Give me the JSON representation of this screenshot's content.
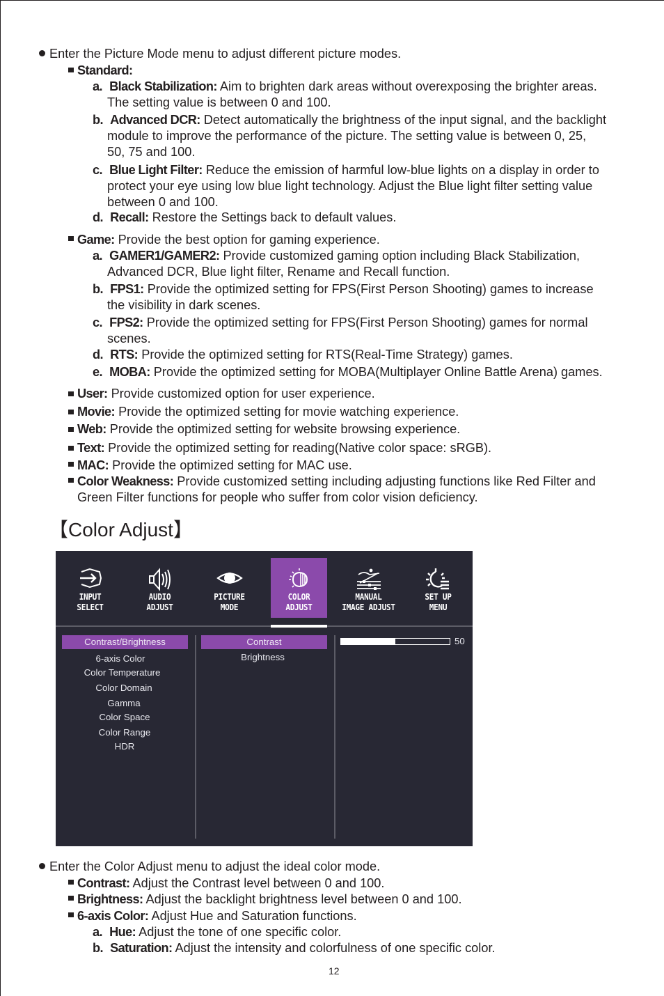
{
  "picture_mode": {
    "intro": "Enter the Picture Mode menu to adjust different picture modes.",
    "standard": {
      "label": "Standard:",
      "items": [
        {
          "letter": "a.",
          "term": "Black Stabilization:",
          "lines": [
            "Aim to brighten dark areas without overexposing the brighter areas.",
            "The setting value is between 0 and 100."
          ]
        },
        {
          "letter": "b.",
          "term": "Advanced DCR:",
          "lines": [
            "Detect automatically the brightness of the input signal, and the backlight",
            "module to improve the performance of the picture. The setting value is between 0, 25,",
            "50, 75 and 100."
          ]
        },
        {
          "letter": "c.",
          "term": "Blue Light Filter:",
          "lines": [
            "Reduce the emission of harmful low-blue lights on a display in order to",
            "protect your eye using low blue light technology. Adjust the Blue light filter setting value",
            "between 0 and 100."
          ]
        },
        {
          "letter": "d.",
          "term": "Recall:",
          "lines": [
            "Restore the Settings back to default values."
          ]
        }
      ]
    },
    "game": {
      "label": "Game:",
      "desc": "Provide the best option for gaming experience.",
      "items": [
        {
          "letter": "a.",
          "term": "GAMER1/GAMER2:",
          "lines": [
            "Provide customized gaming option including Black Stabilization,",
            "Advanced DCR, Blue light filter, Rename and Recall function."
          ]
        },
        {
          "letter": "b.",
          "term": "FPS1:",
          "lines": [
            "Provide the optimized setting for FPS(First Person Shooting) games to increase",
            "the visibility in dark scenes."
          ]
        },
        {
          "letter": "c.",
          "term": "FPS2:",
          "lines": [
            "Provide the optimized setting for FPS(First Person Shooting) games for normal",
            "scenes."
          ]
        },
        {
          "letter": "d.",
          "term": "RTS:",
          "lines": [
            "Provide the optimized setting for RTS(Real-Time Strategy) games."
          ]
        },
        {
          "letter": "e.",
          "term": "MOBA:",
          "lines": [
            "Provide the optimized setting for MOBA(Multiplayer Online Battle Arena) games."
          ]
        }
      ]
    },
    "modes": [
      {
        "term": "User:",
        "desc": "Provide customized option for user experience."
      },
      {
        "term": "Movie:",
        "desc": "Provide the optimized setting for movie watching experience."
      },
      {
        "term": "Web:",
        "desc": "Provide the optimized setting for website browsing experience."
      },
      {
        "term": "Text:",
        "desc": "Provide the optimized setting for reading(Native color space: sRGB)."
      },
      {
        "term": "MAC:",
        "desc": "Provide the optimized setting for MAC use."
      },
      {
        "term": "Color Weakness:",
        "desc": "Provide customized setting including adjusting functions like Red Filter and",
        "desc2": "Green Filter functions for people who suffer from color vision deficiency."
      }
    ]
  },
  "section_title": "【Color Adjust】",
  "osd": {
    "accent_color": "#8b4aab",
    "background_color": "#282834",
    "tabs": [
      {
        "icon": "input-select-icon",
        "line1": "INPUT",
        "line2": "SELECT",
        "active": false
      },
      {
        "icon": "speaker-icon",
        "line1": "AUDIO",
        "line2": "ADJUST",
        "active": false
      },
      {
        "icon": "eye-icon",
        "line1": "PICTURE",
        "line2": "MODE",
        "active": false
      },
      {
        "icon": "color-adjust-icon",
        "line1": "COLOR",
        "line2": "ADJUST",
        "active": true
      },
      {
        "icon": "image-adjust-icon",
        "line1": "MANUAL",
        "line2": "IMAGE ADJUST",
        "active": false
      },
      {
        "icon": "gear-menu-icon",
        "line1": "SET UP",
        "line2": "MENU",
        "active": false
      }
    ],
    "menu_items": [
      "Contrast/Brightness",
      "6-axis Color",
      "Color Temperature",
      "Color Domain",
      "Gamma",
      "Color Space",
      "Color Range",
      "HDR"
    ],
    "selected_menu": "Contrast/Brightness",
    "submenu_items": [
      "Contrast",
      "Brightness"
    ],
    "selected_submenu": "Contrast",
    "slider": {
      "value": 50,
      "max": 100,
      "value_label": "50"
    }
  },
  "color_adjust": {
    "intro": "Enter the Color Adjust menu to adjust the ideal color mode.",
    "items": [
      {
        "term": "Contrast:",
        "desc": "Adjust the Contrast level between 0 and 100."
      },
      {
        "term": "Brightness:",
        "desc": "Adjust the backlight brightness level between 0 and 100."
      },
      {
        "term": "6-axis Color:",
        "desc": "Adjust Hue and Saturation functions."
      }
    ],
    "sub_items": [
      {
        "letter": "a.",
        "term": "Hue:",
        "desc": "Adjust the tone of one specific color."
      },
      {
        "letter": "b.",
        "term": "Saturation:",
        "desc": "Adjust the intensity and colorfulness of one specific color."
      }
    ]
  },
  "page_number": "12"
}
